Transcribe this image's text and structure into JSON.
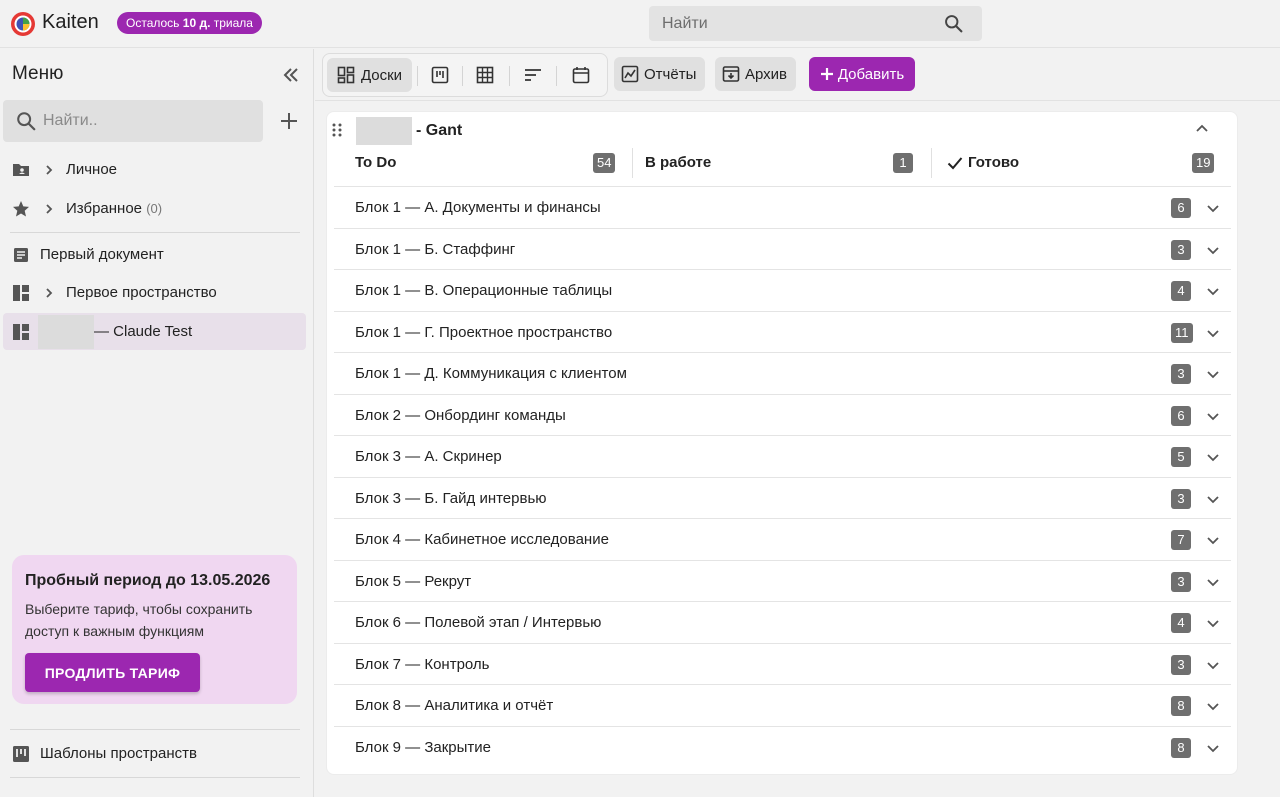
{
  "app": {
    "brand": "Kaiten",
    "trial_badge_prefix": "Осталось ",
    "trial_badge_bold": "10 д.",
    "trial_badge_suffix": " триала",
    "accent": "#9c27b0"
  },
  "top_search": {
    "placeholder": "Найти"
  },
  "sidebar": {
    "menu_title": "Меню",
    "search_placeholder": "Найти..",
    "items": {
      "personal": {
        "label": "Личное"
      },
      "favorites": {
        "label": "Избранное",
        "count": "(0)"
      },
      "first_doc": {
        "label": "Первый документ"
      },
      "first_space": {
        "label": "Первое пространство"
      },
      "claude_test": {
        "label": "— Claude Test"
      }
    },
    "promo": {
      "title": "Пробный период до 13.05.2026",
      "text": "Выберите тариф, чтобы сохранить доступ к важным функциям",
      "button": "ПРОДЛИТЬ ТАРИФ"
    },
    "templates": {
      "label": "Шаблоны пространств"
    }
  },
  "toolbar": {
    "boards_label": "Доски",
    "reports_label": "Отчёты",
    "archive_label": "Архив",
    "add_label": "Добавить"
  },
  "board": {
    "title": "- Gant",
    "columns": [
      {
        "name": "To Do",
        "count": "54"
      },
      {
        "name": "В работе",
        "count": "1"
      },
      {
        "name": "Готово",
        "count": "19"
      }
    ],
    "rows": [
      {
        "label": "Блок 1 — А. Документы и финансы",
        "count": "6"
      },
      {
        "label": "Блок 1 — Б. Стаффинг",
        "count": "3"
      },
      {
        "label": "Блок 1 — В. Операционные таблицы",
        "count": "4"
      },
      {
        "label": "Блок 1 — Г. Проектное пространство",
        "count": "11"
      },
      {
        "label": "Блок 1 — Д. Коммуникация с клиентом",
        "count": "3"
      },
      {
        "label": "Блок 2 — Онбординг команды",
        "count": "6"
      },
      {
        "label": "Блок 3 — А. Скринер",
        "count": "5"
      },
      {
        "label": "Блок 3 — Б. Гайд интервью",
        "count": "3"
      },
      {
        "label": "Блок 4 — Кабинетное исследование",
        "count": "7"
      },
      {
        "label": "Блок 5 — Рекрут",
        "count": "3"
      },
      {
        "label": "Блок 6 — Полевой этап / Интервью",
        "count": "4"
      },
      {
        "label": "Блок 7 — Контроль",
        "count": "3"
      },
      {
        "label": "Блок 8 — Аналитика и отчёт",
        "count": "8"
      },
      {
        "label": "Блок 9 — Закрытие",
        "count": "8"
      }
    ]
  }
}
